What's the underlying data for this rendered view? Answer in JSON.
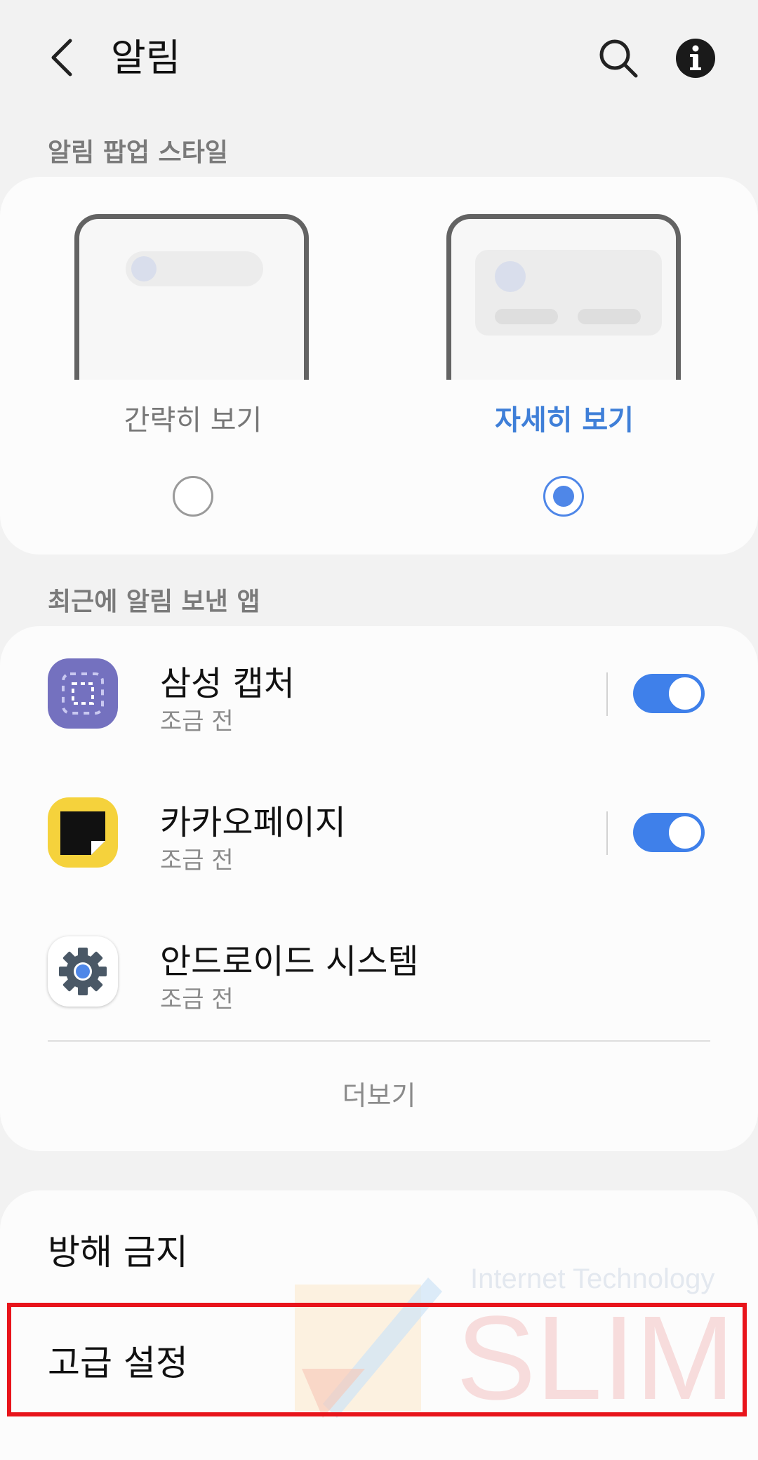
{
  "header": {
    "title": "알림",
    "back_icon": "chevron-left-icon",
    "search_icon": "search-icon",
    "info_icon": "info-icon"
  },
  "popup_style": {
    "section_label": "알림 팝업 스타일",
    "options": [
      {
        "label": "간략히 보기",
        "selected": false
      },
      {
        "label": "자세히 보기",
        "selected": true
      }
    ],
    "accent_color": "#4f87e8"
  },
  "recent_apps": {
    "section_label": "최근에 알림 보낸 앱",
    "items": [
      {
        "name": "삼성 캡처",
        "time": "조금 전",
        "icon": "screenshot-capture-icon",
        "toggle_on": true
      },
      {
        "name": "카카오페이지",
        "time": "조금 전",
        "icon": "kakaopage-icon",
        "toggle_on": true
      },
      {
        "name": "안드로이드 시스템",
        "time": "조금 전",
        "icon": "gear-icon",
        "toggle_on": null
      }
    ],
    "more_label": "더보기"
  },
  "settings": {
    "items": [
      {
        "label": "방해 금지"
      },
      {
        "label": "고급 설정"
      }
    ]
  },
  "watermark": {
    "line1": "Internet Technology",
    "line2": "SLIM"
  }
}
